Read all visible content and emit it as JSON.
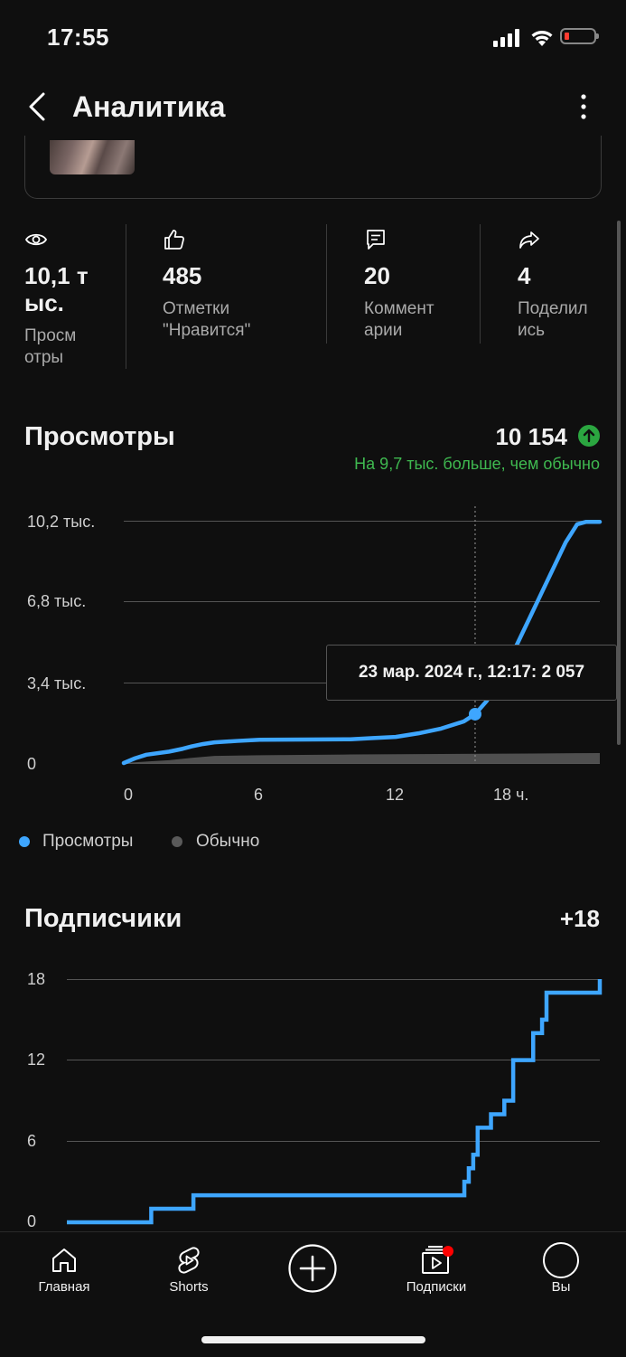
{
  "status_bar": {
    "time": "17:55"
  },
  "header": {
    "title": "Аналитика"
  },
  "stats": [
    {
      "icon": "eye-icon",
      "value": "10,1 т\nыс.",
      "label": "Просм\nотры"
    },
    {
      "icon": "thumbs-up-icon",
      "value": "485",
      "label": "Отметки\n\"Нравится\""
    },
    {
      "icon": "comment-icon",
      "value": "20",
      "label": "Коммент\nарии"
    },
    {
      "icon": "share-icon",
      "value": "4",
      "label": "Поделил\nись"
    }
  ],
  "views": {
    "title": "Просмотры",
    "total": "10 154",
    "note": "На 9,7 тыс. больше, чем обычно",
    "tooltip": "23 мар. 2024 г., 12:17: 2 057",
    "legend": [
      {
        "label": "Просмотры",
        "color": "#3ea6ff"
      },
      {
        "label": "Обычно",
        "color": "#5a5a5a"
      }
    ]
  },
  "subscribers": {
    "title": "Подписчики",
    "total": "+18"
  },
  "colors": {
    "accent": "#3ea6ff",
    "positive": "#3fb950",
    "notification": "#ff0000"
  },
  "chart_data": [
    {
      "type": "line",
      "title": "Просмотры",
      "x_tick_labels": [
        "0",
        "6",
        "12",
        "18 ч."
      ],
      "y_tick_labels": [
        "10,2 тыс.",
        "6,8 тыс.",
        "3,4 тыс.",
        "0"
      ],
      "ylim": [
        0,
        10200
      ],
      "xlim": [
        0,
        21
      ],
      "grid": true,
      "legend_position": "bottom-left",
      "series": [
        {
          "name": "Просмотры",
          "x": [
            0,
            0.5,
            1,
            2,
            2.6,
            3,
            3.5,
            4,
            5,
            6,
            8,
            10,
            11,
            12,
            13,
            14,
            15,
            15.5,
            16,
            16.5,
            17,
            17.5,
            18,
            18.5,
            19,
            19.5,
            20,
            20.4,
            20.6,
            21
          ],
          "y": [
            0,
            200,
            350,
            480,
            600,
            700,
            800,
            870,
            930,
            980,
            990,
            1000,
            1050,
            1100,
            1250,
            1450,
            1750,
            2057,
            2600,
            3400,
            4300,
            5300,
            6300,
            7300,
            8300,
            9300,
            10050,
            10154,
            10154,
            10154
          ]
        },
        {
          "name": "Обычно",
          "x": [
            0,
            1,
            2,
            3,
            4,
            6,
            10,
            14,
            18,
            21
          ],
          "y": [
            0,
            60,
            120,
            220,
            300,
            330,
            360,
            380,
            400,
            420
          ]
        }
      ],
      "tooltip_point": {
        "x": 15.5,
        "y": 2057
      }
    },
    {
      "type": "line",
      "title": "Подписчики",
      "y_tick_labels": [
        "18",
        "12",
        "6",
        "0"
      ],
      "ylim": [
        0,
        18
      ],
      "xlim": [
        0,
        21
      ],
      "grid": true,
      "series": [
        {
          "step": true,
          "x": [
            0,
            3.8,
            5.7,
            15.5,
            17.9,
            18.1,
            18.3,
            18.5,
            19.1,
            19.7,
            20.1,
            21.0,
            21.4,
            21.6,
            24
          ],
          "y": [
            0,
            1,
            2,
            2,
            3,
            4,
            5,
            7,
            8,
            9,
            12,
            14,
            15,
            17,
            18
          ]
        }
      ]
    }
  ]
}
